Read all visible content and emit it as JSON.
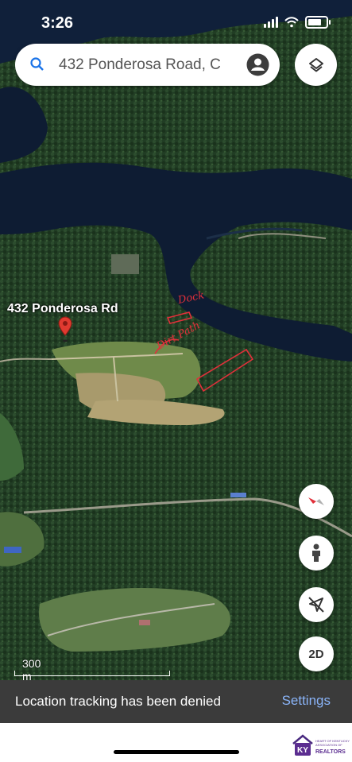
{
  "status_bar": {
    "time": "3:26"
  },
  "search": {
    "query": "432 Ponderosa Road, C"
  },
  "map": {
    "pin_label": "432 Ponderosa Rd",
    "annotations": [
      "Dock",
      "Dirt Path"
    ],
    "scale_label": "300 m"
  },
  "controls": {
    "view_mode_label": "2D"
  },
  "snackbar": {
    "message": "Location tracking has been denied",
    "action_label": "Settings"
  },
  "logo": {
    "monogram": "KY",
    "text": "HEART OF KENTUCKY ASSOCIATION OF REALTORS"
  },
  "colors": {
    "water": "#0e1c33",
    "forest": "#1f3b22",
    "field": "#8a9a5a",
    "annotation": "#e0303a",
    "link": "#8ab4f8"
  }
}
